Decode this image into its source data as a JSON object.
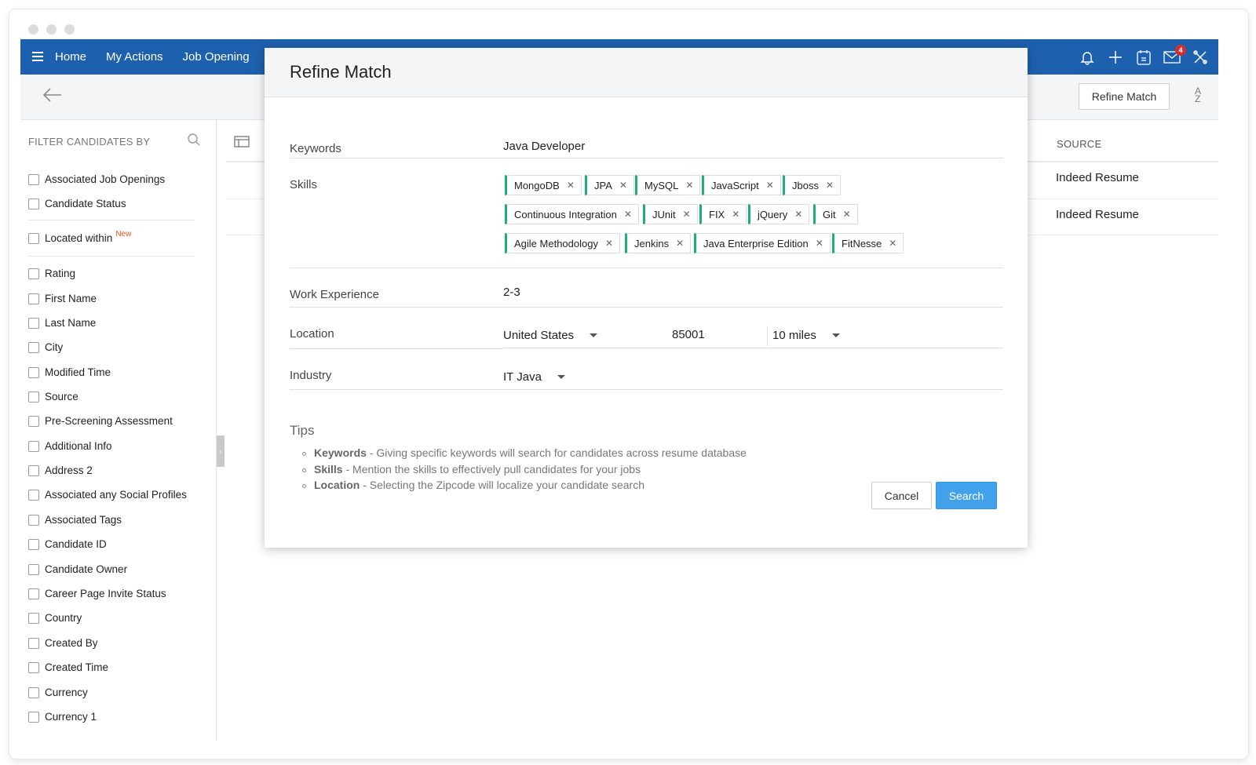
{
  "nav": {
    "items": [
      "Home",
      "My Actions",
      "Job Opening"
    ],
    "notification_count": "4"
  },
  "toolbar": {
    "refine_match_label": "Refine Match",
    "sort_a": "A",
    "sort_z": "Z"
  },
  "sidebar": {
    "heading": "FILTER CANDIDATES BY",
    "group1": [
      "Associated Job Openings",
      "Candidate Status"
    ],
    "located_within": "Located within",
    "new_tag": "New",
    "filters": [
      "Rating",
      "First Name",
      "Last Name",
      "City",
      "Modified Time",
      "Source",
      "Pre-Screening Assessment",
      "Additional Info",
      "Address 2",
      "Associated any Social Profiles",
      "Associated Tags",
      "Candidate ID",
      "Candidate Owner",
      "Career Page Invite Status",
      "Country",
      "Created By",
      "Created Time",
      "Currency",
      "Currency 1"
    ]
  },
  "table": {
    "source_header": "SOURCE",
    "rows": [
      "Indeed Resume",
      "Indeed Resume"
    ]
  },
  "modal": {
    "title": "Refine Match",
    "keywords_label": "Keywords",
    "keywords_value": "Java Developer",
    "skills_label": "Skills",
    "skills": [
      [
        "MongoDB",
        "JPA",
        "MySQL",
        "JavaScript",
        "Jboss"
      ],
      [
        "Continuous Integration",
        "JUnit",
        "FIX",
        "jQuery",
        "Git"
      ],
      [
        "Agile Methodology",
        "Jenkins",
        "Java Enterprise Edition",
        "FitNesse"
      ]
    ],
    "skill_tag_color": "#1eae7b",
    "work_experience_label": "Work Experience",
    "work_experience_value": "2-3",
    "location_label": "Location",
    "country": "United States",
    "zipcode": "85001",
    "radius": "10 miles",
    "industry_label": "Industry",
    "industry_value": "IT Java",
    "tips_title": "Tips",
    "tips": [
      {
        "term": "Keywords",
        "text": " - Giving specific keywords will search for candidates across resume database"
      },
      {
        "term": "Skills",
        "text": " - Mention the skills to effectively pull candidates for your jobs"
      },
      {
        "term": "Location",
        "text": " - Selecting the Zipcode will localize your candidate search"
      }
    ],
    "cancel_label": "Cancel",
    "search_label": "Search",
    "search_color": "#41a2eb"
  },
  "brand_color": "#1d60ae"
}
